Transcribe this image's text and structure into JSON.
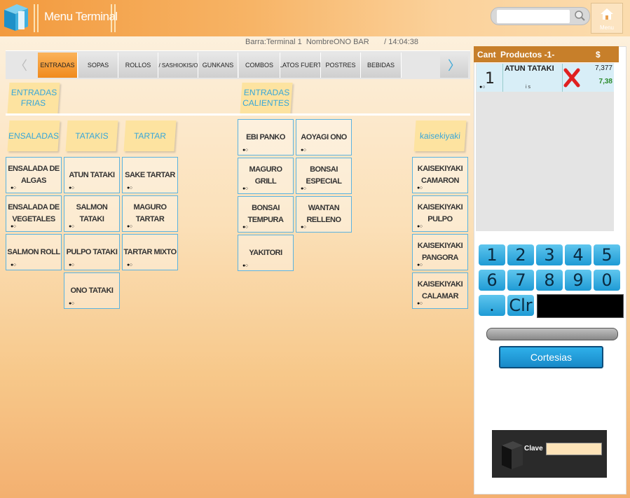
{
  "header": {
    "title": "Menu Terminal",
    "search": {
      "value": "",
      "placeholder": ""
    },
    "home_label": "Menu"
  },
  "info": {
    "barra": "Barra:Terminal 1",
    "nombre": "NombreONO BAR",
    "time": "/ 14:04:38"
  },
  "categories": {
    "prev": "〈",
    "next": "〉",
    "items": [
      "ENTRADAS",
      "SOPAS",
      "ROLLOS",
      "NIGIRIS / SASHIOKIS/OSHIZU/T",
      "GUNKANS",
      "COMBOS",
      "PLATOS FUERTE",
      "POSTRES",
      "BEBIDAS"
    ],
    "active": "ENTRADAS"
  },
  "groups": {
    "frias": "ENTRADAS FRIAS",
    "calientes": "ENTRADAS CALIENTES"
  },
  "subgroups": {
    "ensaladas": "ENSALADAS",
    "tatakis": "TATAKIS",
    "tartar": "TARTAR",
    "kaiseki": "kaisekiyaki"
  },
  "products": {
    "ensaladas": [
      "ENSALADA DE ALGAS",
      "ENSALADA DE VEGETALES",
      "SALMON ROLL"
    ],
    "tatakis": [
      "ATUN TATAKI",
      "SALMON TATAKI",
      "PULPO TATAKI",
      "ONO TATAKI"
    ],
    "tartar": [
      "SAKE TARTAR",
      "MAGURO TARTAR",
      "TARTAR MIXTO"
    ],
    "calientes_col1": [
      "EBI PANKO",
      "MAGURO GRILL",
      "BONSAI TEMPURA",
      "YAKITORI"
    ],
    "calientes_col2": [
      "AOYAGI ONO",
      "BONSAI ESPECIAL",
      "WANTAN RELLENO"
    ],
    "kaiseki": [
      "KAISEKIYAKI CAMARON",
      "KAISEKIYAKI PULPO",
      "KAISEKIYAKI PANGORA",
      "KAISEKIYAKI CALAMAR"
    ]
  },
  "order": {
    "headers": {
      "cant": "Cant",
      "producto": "Productos -1-",
      "price": "$"
    },
    "items": [
      {
        "qty": "1",
        "name": "ATUN TATAKI",
        "note": "i s",
        "price": "7,377",
        "total": "7,38"
      }
    ]
  },
  "keypad": {
    "keys": [
      "1",
      "2",
      "3",
      "4",
      "5",
      "6",
      "7",
      "8",
      "9",
      "0",
      ".",
      "Clr"
    ],
    "display": ""
  },
  "actions": {
    "cortesias": "Cortesias"
  },
  "clave": {
    "label": "Clave",
    "value": ""
  },
  "colors": {
    "accent": "#f08a1d",
    "tile_border": "#5bb3e0",
    "key_blue": "#1f9bd5",
    "order_header": "#c77f2a"
  }
}
